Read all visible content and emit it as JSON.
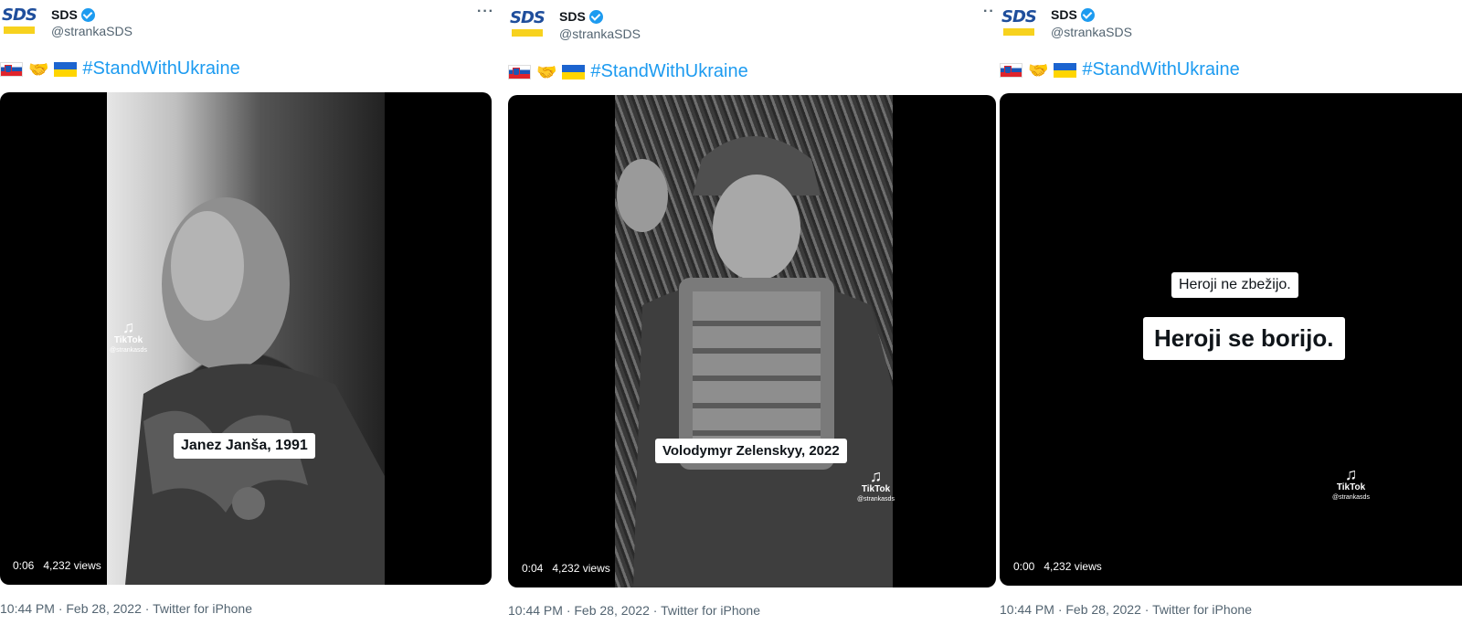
{
  "tweets": [
    {
      "name": "SDS",
      "handle": "@strankaSDS",
      "avatar_text": "SDS",
      "hashtag": "#StandWithUkraine",
      "more": "···",
      "caption": "Janez Janša, 1991",
      "video_time": "0:06",
      "views": "4,232 views",
      "tiktok_label": "TikTok",
      "tiktok_user": "@strankasds",
      "footer": "10:44 PM · Feb 28, 2022 · Twitter for iPhone"
    },
    {
      "name": "SDS",
      "handle": "@strankaSDS",
      "avatar_text": "SDS",
      "hashtag": "#StandWithUkraine",
      "more": "··",
      "caption": "Volodymyr Zelenskyy, 2022",
      "video_time": "0:04",
      "views": "4,232 views",
      "tiktok_label": "TikTok",
      "tiktok_user": "@strankasds",
      "footer": "10:44 PM · Feb 28, 2022 · Twitter for iPhone"
    },
    {
      "name": "SDS",
      "handle": "@strankaSDS",
      "avatar_text": "SDS",
      "hashtag": "#StandWithUkraine",
      "caption_top": "Heroji ne zbežijo.",
      "caption_main": "Heroji se borijo.",
      "video_time": "0:00",
      "views": "4,232 views",
      "tiktok_label": "TikTok",
      "tiktok_user": "@strankasds",
      "footer": "10:44 PM · Feb 28, 2022 · Twitter for iPhone"
    }
  ],
  "colors": {
    "link": "#1d9bf0",
    "brand_blue": "#1f4e9c",
    "brand_yellow": "#f7d21e",
    "muted": "#536471"
  },
  "icons": {
    "verified": "verified-badge-icon",
    "tiktok": "tiktok-icon",
    "more": "more-options-icon"
  }
}
